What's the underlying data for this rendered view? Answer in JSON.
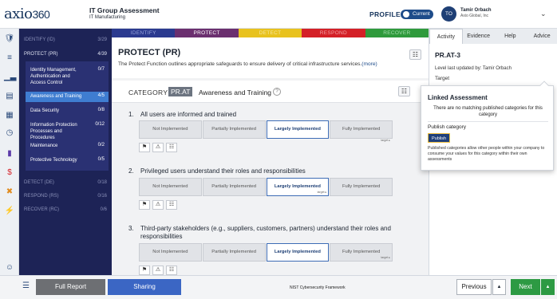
{
  "header": {
    "logo_text": "axio",
    "logo_num": "360",
    "title": "IT Group Assessment",
    "subtitle": "IT Manufacturing",
    "profile_label": "PROFILE:",
    "profile_toggle": "Current",
    "avatar_initials": "TO",
    "user_name": "Tamir Orbach",
    "user_org": "Axio Global, Inc",
    "caret": "⌄"
  },
  "rail_icons": [
    "shield-icon",
    "layers-icon",
    "bar-chart-icon",
    "document-icon",
    "calendar-icon",
    "clock-icon",
    "file-icon",
    "dollar-icon",
    "tools-icon",
    "bolt-icon",
    "smile-icon",
    "expand-icon"
  ],
  "sidebar": {
    "identify": {
      "label": "IDENTIFY (ID)",
      "count": "3/29"
    },
    "protect": {
      "label": "PROTECT (PR)",
      "count": "4/39"
    },
    "items": [
      {
        "label": "Identity Management, Authentication and Access Control",
        "count": "0/7"
      },
      {
        "label": "Awareness and Training",
        "count": "4/5"
      },
      {
        "label": "Data Security",
        "count": "0/8"
      },
      {
        "label": "Information Protection Processes and Procedures",
        "count": "0/12"
      },
      {
        "label": "Maintenance",
        "count": "0/2"
      },
      {
        "label": "Protective Technology",
        "count": "0/5"
      }
    ],
    "detect": {
      "label": "DETECT (DE)",
      "count": "0/18"
    },
    "respond": {
      "label": "RESPOND (RS)",
      "count": "0/16"
    },
    "recover": {
      "label": "RECOVER (RC)",
      "count": "0/6"
    }
  },
  "function_tabs": [
    {
      "label": "IDENTIFY",
      "color": "#2b3a8f"
    },
    {
      "label": "PROTECT",
      "color": "#6b2f6f"
    },
    {
      "label": "DETECT",
      "color": "#e8c21e"
    },
    {
      "label": "RESPOND",
      "color": "#d42027"
    },
    {
      "label": "RECOVER",
      "color": "#2f9a3c"
    }
  ],
  "main": {
    "title": "PROTECT (PR)",
    "description": "The Protect Function outlines appropriate safeguards to ensure delivery of critical infrastructure services.",
    "more": "(more)",
    "category_label": "CATEGORY",
    "category_code": "PR.AT",
    "category_name": "Awareness and Training",
    "help": "?"
  },
  "questions": [
    {
      "number": "1.",
      "text": "All users are informed and trained",
      "selected": 2
    },
    {
      "number": "2.",
      "text": "Privileged users understand their roles and responsibilities",
      "selected": 2
    },
    {
      "number": "3.",
      "text": "Third-party stakeholders (e.g., suppliers, customers, partners) understand their roles and responsibilities",
      "selected": 2
    }
  ],
  "options": [
    "Not Implemented",
    "Partially Implemented",
    "Largely Implemented",
    "Fully Implemented"
  ],
  "target_label": "target ▸",
  "tool_icons": [
    "flag-icon",
    "warning-icon",
    "hierarchy-icon"
  ],
  "right_panel": {
    "tabs": [
      "Activity",
      "Evidence",
      "Help",
      "Advice"
    ],
    "id": "PR.AT-3",
    "updated": "Level last updated by: Tamir Orbach",
    "target": "Target"
  },
  "popover": {
    "title": "Linked Assessment",
    "none": "There are no matching published categories for this category",
    "publish_category": "Publish category",
    "publish_button": "Publish",
    "desc": "Published categories allow other people within your company to consume your values for this category within their own assessments"
  },
  "footer": {
    "full_report": "Full Report",
    "sharing": "Sharing",
    "framework": "NIST Cybersecurity Framework",
    "previous": "Previous",
    "next": "Next"
  }
}
